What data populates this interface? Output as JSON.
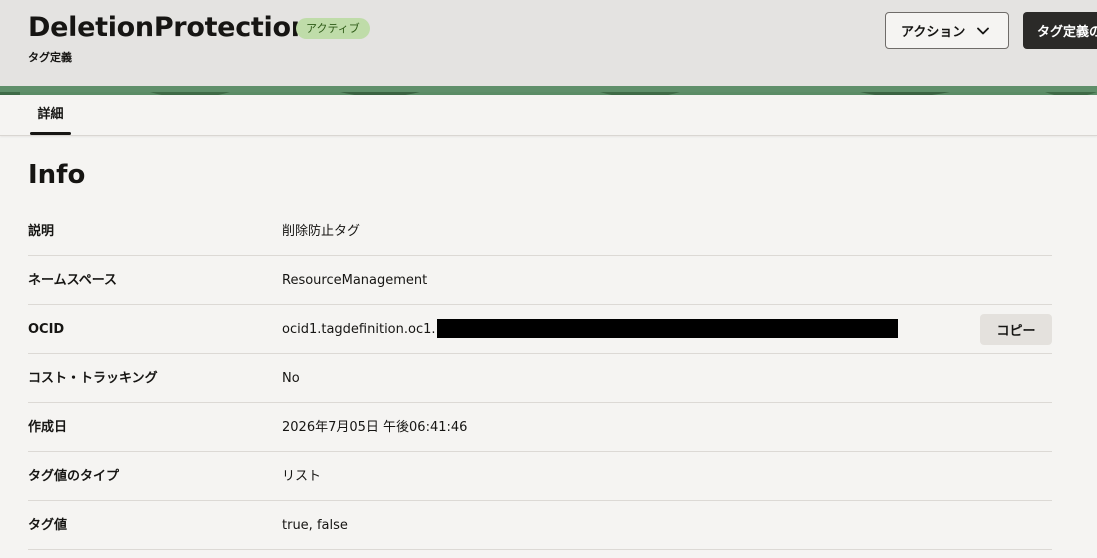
{
  "header": {
    "title": "DeletionProtection",
    "status_badge": "アクティブ",
    "subtitle": "タグ定義",
    "actions_button": "アクション",
    "edit_button": "タグ定義の"
  },
  "tabs": [
    {
      "label": "詳細",
      "selected": true
    }
  ],
  "info": {
    "section_title": "Info",
    "rows": [
      {
        "label": "説明",
        "value": "削除防止タグ"
      },
      {
        "label": "ネームスペース",
        "value": "ResourceManagement"
      },
      {
        "label": "OCID",
        "value": "ocid1.tagdefinition.oc1.",
        "redacted": true,
        "copy_label": "コピー"
      },
      {
        "label": "コスト・トラッキング",
        "value": "No"
      },
      {
        "label": "作成日",
        "value": "2026年7月05日 午後06:41:46"
      },
      {
        "label": "タグ値のタイプ",
        "value": "リスト"
      },
      {
        "label": "タグ値",
        "value": "true, false"
      }
    ]
  },
  "colors": {
    "header_bg": "#e4e3e1",
    "page_bg": "#f5f4f2",
    "badge_bg": "#bfdca9",
    "badge_text": "#2d5a16",
    "dark_button_bg": "#2b2a28"
  },
  "icons": {
    "actions_dropdown": "chevron-down-icon"
  }
}
